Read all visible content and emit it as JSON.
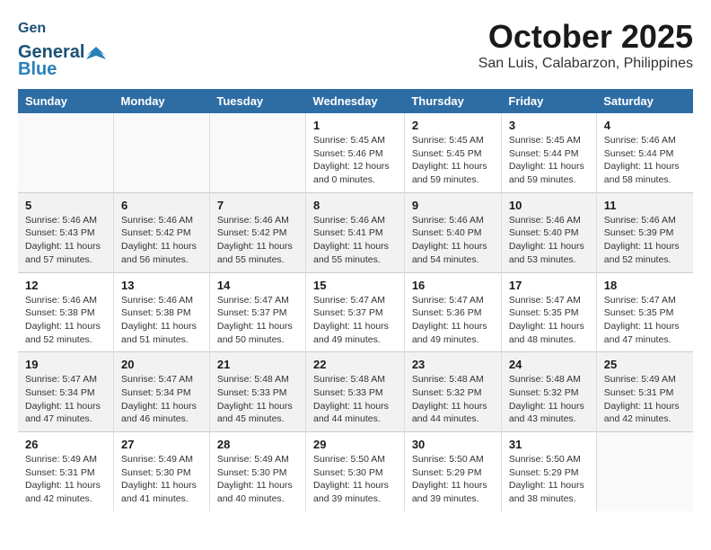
{
  "header": {
    "logo_line1": "General",
    "logo_line2": "Blue",
    "title": "October 2025",
    "subtitle": "San Luis, Calabarzon, Philippines"
  },
  "weekdays": [
    "Sunday",
    "Monday",
    "Tuesday",
    "Wednesday",
    "Thursday",
    "Friday",
    "Saturday"
  ],
  "weeks": [
    [
      {
        "day": "",
        "info": ""
      },
      {
        "day": "",
        "info": ""
      },
      {
        "day": "",
        "info": ""
      },
      {
        "day": "1",
        "info": "Sunrise: 5:45 AM\nSunset: 5:46 PM\nDaylight: 12 hours\nand 0 minutes."
      },
      {
        "day": "2",
        "info": "Sunrise: 5:45 AM\nSunset: 5:45 PM\nDaylight: 11 hours\nand 59 minutes."
      },
      {
        "day": "3",
        "info": "Sunrise: 5:45 AM\nSunset: 5:44 PM\nDaylight: 11 hours\nand 59 minutes."
      },
      {
        "day": "4",
        "info": "Sunrise: 5:46 AM\nSunset: 5:44 PM\nDaylight: 11 hours\nand 58 minutes."
      }
    ],
    [
      {
        "day": "5",
        "info": "Sunrise: 5:46 AM\nSunset: 5:43 PM\nDaylight: 11 hours\nand 57 minutes."
      },
      {
        "day": "6",
        "info": "Sunrise: 5:46 AM\nSunset: 5:42 PM\nDaylight: 11 hours\nand 56 minutes."
      },
      {
        "day": "7",
        "info": "Sunrise: 5:46 AM\nSunset: 5:42 PM\nDaylight: 11 hours\nand 55 minutes."
      },
      {
        "day": "8",
        "info": "Sunrise: 5:46 AM\nSunset: 5:41 PM\nDaylight: 11 hours\nand 55 minutes."
      },
      {
        "day": "9",
        "info": "Sunrise: 5:46 AM\nSunset: 5:40 PM\nDaylight: 11 hours\nand 54 minutes."
      },
      {
        "day": "10",
        "info": "Sunrise: 5:46 AM\nSunset: 5:40 PM\nDaylight: 11 hours\nand 53 minutes."
      },
      {
        "day": "11",
        "info": "Sunrise: 5:46 AM\nSunset: 5:39 PM\nDaylight: 11 hours\nand 52 minutes."
      }
    ],
    [
      {
        "day": "12",
        "info": "Sunrise: 5:46 AM\nSunset: 5:38 PM\nDaylight: 11 hours\nand 52 minutes."
      },
      {
        "day": "13",
        "info": "Sunrise: 5:46 AM\nSunset: 5:38 PM\nDaylight: 11 hours\nand 51 minutes."
      },
      {
        "day": "14",
        "info": "Sunrise: 5:47 AM\nSunset: 5:37 PM\nDaylight: 11 hours\nand 50 minutes."
      },
      {
        "day": "15",
        "info": "Sunrise: 5:47 AM\nSunset: 5:37 PM\nDaylight: 11 hours\nand 49 minutes."
      },
      {
        "day": "16",
        "info": "Sunrise: 5:47 AM\nSunset: 5:36 PM\nDaylight: 11 hours\nand 49 minutes."
      },
      {
        "day": "17",
        "info": "Sunrise: 5:47 AM\nSunset: 5:35 PM\nDaylight: 11 hours\nand 48 minutes."
      },
      {
        "day": "18",
        "info": "Sunrise: 5:47 AM\nSunset: 5:35 PM\nDaylight: 11 hours\nand 47 minutes."
      }
    ],
    [
      {
        "day": "19",
        "info": "Sunrise: 5:47 AM\nSunset: 5:34 PM\nDaylight: 11 hours\nand 47 minutes."
      },
      {
        "day": "20",
        "info": "Sunrise: 5:47 AM\nSunset: 5:34 PM\nDaylight: 11 hours\nand 46 minutes."
      },
      {
        "day": "21",
        "info": "Sunrise: 5:48 AM\nSunset: 5:33 PM\nDaylight: 11 hours\nand 45 minutes."
      },
      {
        "day": "22",
        "info": "Sunrise: 5:48 AM\nSunset: 5:33 PM\nDaylight: 11 hours\nand 44 minutes."
      },
      {
        "day": "23",
        "info": "Sunrise: 5:48 AM\nSunset: 5:32 PM\nDaylight: 11 hours\nand 44 minutes."
      },
      {
        "day": "24",
        "info": "Sunrise: 5:48 AM\nSunset: 5:32 PM\nDaylight: 11 hours\nand 43 minutes."
      },
      {
        "day": "25",
        "info": "Sunrise: 5:49 AM\nSunset: 5:31 PM\nDaylight: 11 hours\nand 42 minutes."
      }
    ],
    [
      {
        "day": "26",
        "info": "Sunrise: 5:49 AM\nSunset: 5:31 PM\nDaylight: 11 hours\nand 42 minutes."
      },
      {
        "day": "27",
        "info": "Sunrise: 5:49 AM\nSunset: 5:30 PM\nDaylight: 11 hours\nand 41 minutes."
      },
      {
        "day": "28",
        "info": "Sunrise: 5:49 AM\nSunset: 5:30 PM\nDaylight: 11 hours\nand 40 minutes."
      },
      {
        "day": "29",
        "info": "Sunrise: 5:50 AM\nSunset: 5:30 PM\nDaylight: 11 hours\nand 39 minutes."
      },
      {
        "day": "30",
        "info": "Sunrise: 5:50 AM\nSunset: 5:29 PM\nDaylight: 11 hours\nand 39 minutes."
      },
      {
        "day": "31",
        "info": "Sunrise: 5:50 AM\nSunset: 5:29 PM\nDaylight: 11 hours\nand 38 minutes."
      },
      {
        "day": "",
        "info": ""
      }
    ]
  ]
}
